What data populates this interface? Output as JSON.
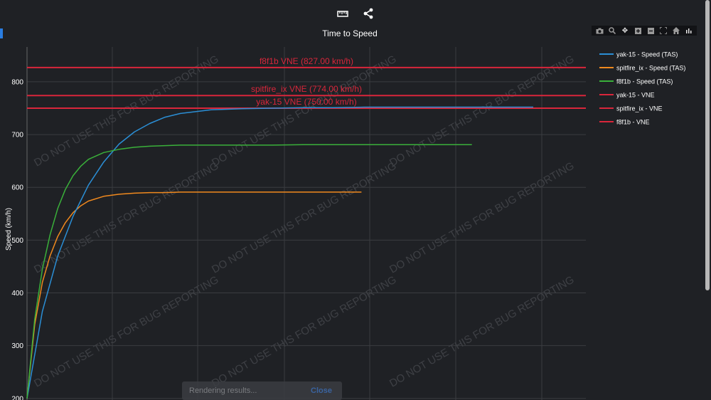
{
  "toolbar": {
    "icons": [
      "ruler-icon",
      "share-icon"
    ]
  },
  "modebar": {
    "icons": [
      "camera-icon",
      "zoom-icon",
      "pan-icon",
      "zoom-in-icon",
      "zoom-out-icon",
      "autoscale-icon",
      "reset-axes-icon",
      "plotly-logo-icon"
    ]
  },
  "colors": {
    "background": "#1f2125",
    "grid": "#3a3c40",
    "yak15": "#2b8fd6",
    "spitfire": "#f0891e",
    "f8f1b": "#3ab03a",
    "vne": "#d9263b",
    "watermark": "#3e4045"
  },
  "watermark_text": "DO NOT USE THIS FOR BUG REPORTING",
  "chart_data": {
    "type": "line",
    "title": "Time to Speed",
    "xlabel": "",
    "ylabel": "Speed (km/h)",
    "ylim": [
      197,
      866
    ],
    "yticks": [
      200,
      300,
      400,
      500,
      600,
      700,
      800
    ],
    "grid": true,
    "legend_position": "right",
    "series": [
      {
        "name": "yak-15 - Speed (TAS)",
        "kind": "curve",
        "x": [
          0,
          10,
          20,
          30,
          40,
          50,
          60,
          70,
          80,
          90,
          100,
          120,
          140,
          160,
          180,
          200,
          220,
          240,
          260,
          280,
          300,
          330
        ],
        "values": [
          200,
          365,
          470,
          545,
          604,
          648,
          682,
          705,
          721,
          733,
          740,
          747,
          749,
          750,
          751,
          751,
          752,
          752,
          752,
          752,
          752,
          752
        ]
      },
      {
        "name": "spitfire_ix - Speed (TAS)",
        "kind": "curve",
        "x": [
          0,
          5,
          10,
          15,
          20,
          25,
          30,
          35,
          40,
          50,
          60,
          70,
          80,
          90,
          100,
          120,
          140,
          160,
          180,
          200,
          218
        ],
        "values": [
          200,
          340,
          420,
          470,
          507,
          533,
          552,
          565,
          574,
          583,
          587,
          589,
          590,
          590,
          591,
          591,
          591,
          591,
          591,
          591,
          591
        ]
      },
      {
        "name": "f8f1b - Speed (TAS)",
        "kind": "curve",
        "x": [
          0,
          5,
          10,
          15,
          20,
          25,
          30,
          35,
          40,
          50,
          60,
          70,
          80,
          90,
          100,
          120,
          140,
          160,
          180,
          200,
          220,
          240,
          260,
          290
        ],
        "values": [
          200,
          350,
          445,
          510,
          560,
          596,
          622,
          640,
          653,
          666,
          672,
          676,
          678,
          679,
          680,
          680,
          680,
          680,
          681,
          681,
          681,
          681,
          681,
          681
        ]
      },
      {
        "name": "yak-15 - VNE",
        "kind": "vne",
        "value": 750,
        "label": "yak-15 VNE (750.00 km/h)"
      },
      {
        "name": "spitfire_ix - VNE",
        "kind": "vne",
        "value": 774,
        "label": "spitfire_ix VNE (774.00 km/h)"
      },
      {
        "name": "f8f1b - VNE",
        "kind": "vne",
        "value": 827,
        "label": "f8f1b VNE (827.00 km/h)"
      }
    ]
  },
  "toast": {
    "message": "Rendering results...",
    "close_label": "Close"
  }
}
